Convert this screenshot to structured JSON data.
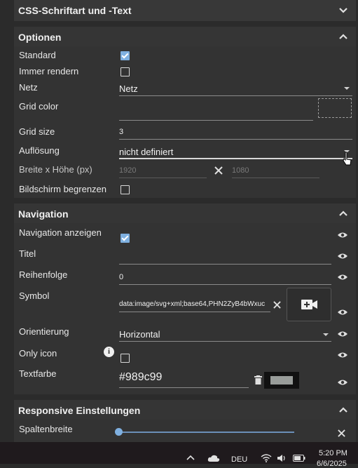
{
  "css_panel": {
    "title": "CSS-Schriftart und -Text"
  },
  "options": {
    "title": "Optionen",
    "standard_label": "Standard",
    "render_label": "Immer rendern",
    "grid_label": "Netz",
    "grid_value": "Netz",
    "grid_color_label": "Grid color",
    "grid_size_label": "Grid size",
    "grid_size_value": "3",
    "resolution_label": "Auflösung",
    "resolution_value": "nicht definiert",
    "size_label": "Breite x Höhe (px)",
    "width_value": "1920",
    "height_value": "1080",
    "limit_label": "Bildschirm begrenzen"
  },
  "navigation": {
    "title": "Navigation",
    "show_label": "Navigation anzeigen",
    "title_label": "Titel",
    "order_label": "Reihenfolge",
    "order_value": "0",
    "symbol_label": "Symbol",
    "symbol_value": "data:image/svg+xml;base64,PHN2ZyB4bWxuc",
    "orientation_label": "Orientierung",
    "orientation_value": "Horizontal",
    "only_icon_label": "Only icon",
    "text_color_label": "Textfarbe",
    "text_color_value": "#989c99"
  },
  "responsive": {
    "title": "Responsive Einstellungen",
    "column_width_label": "Spaltenbreite"
  },
  "taskbar": {
    "lang": "DEU",
    "time": "5:20 PM",
    "date": "6/6/2025"
  },
  "colors": {
    "accent": "#7fb0e0",
    "text_color_swatch": "#989c99"
  }
}
